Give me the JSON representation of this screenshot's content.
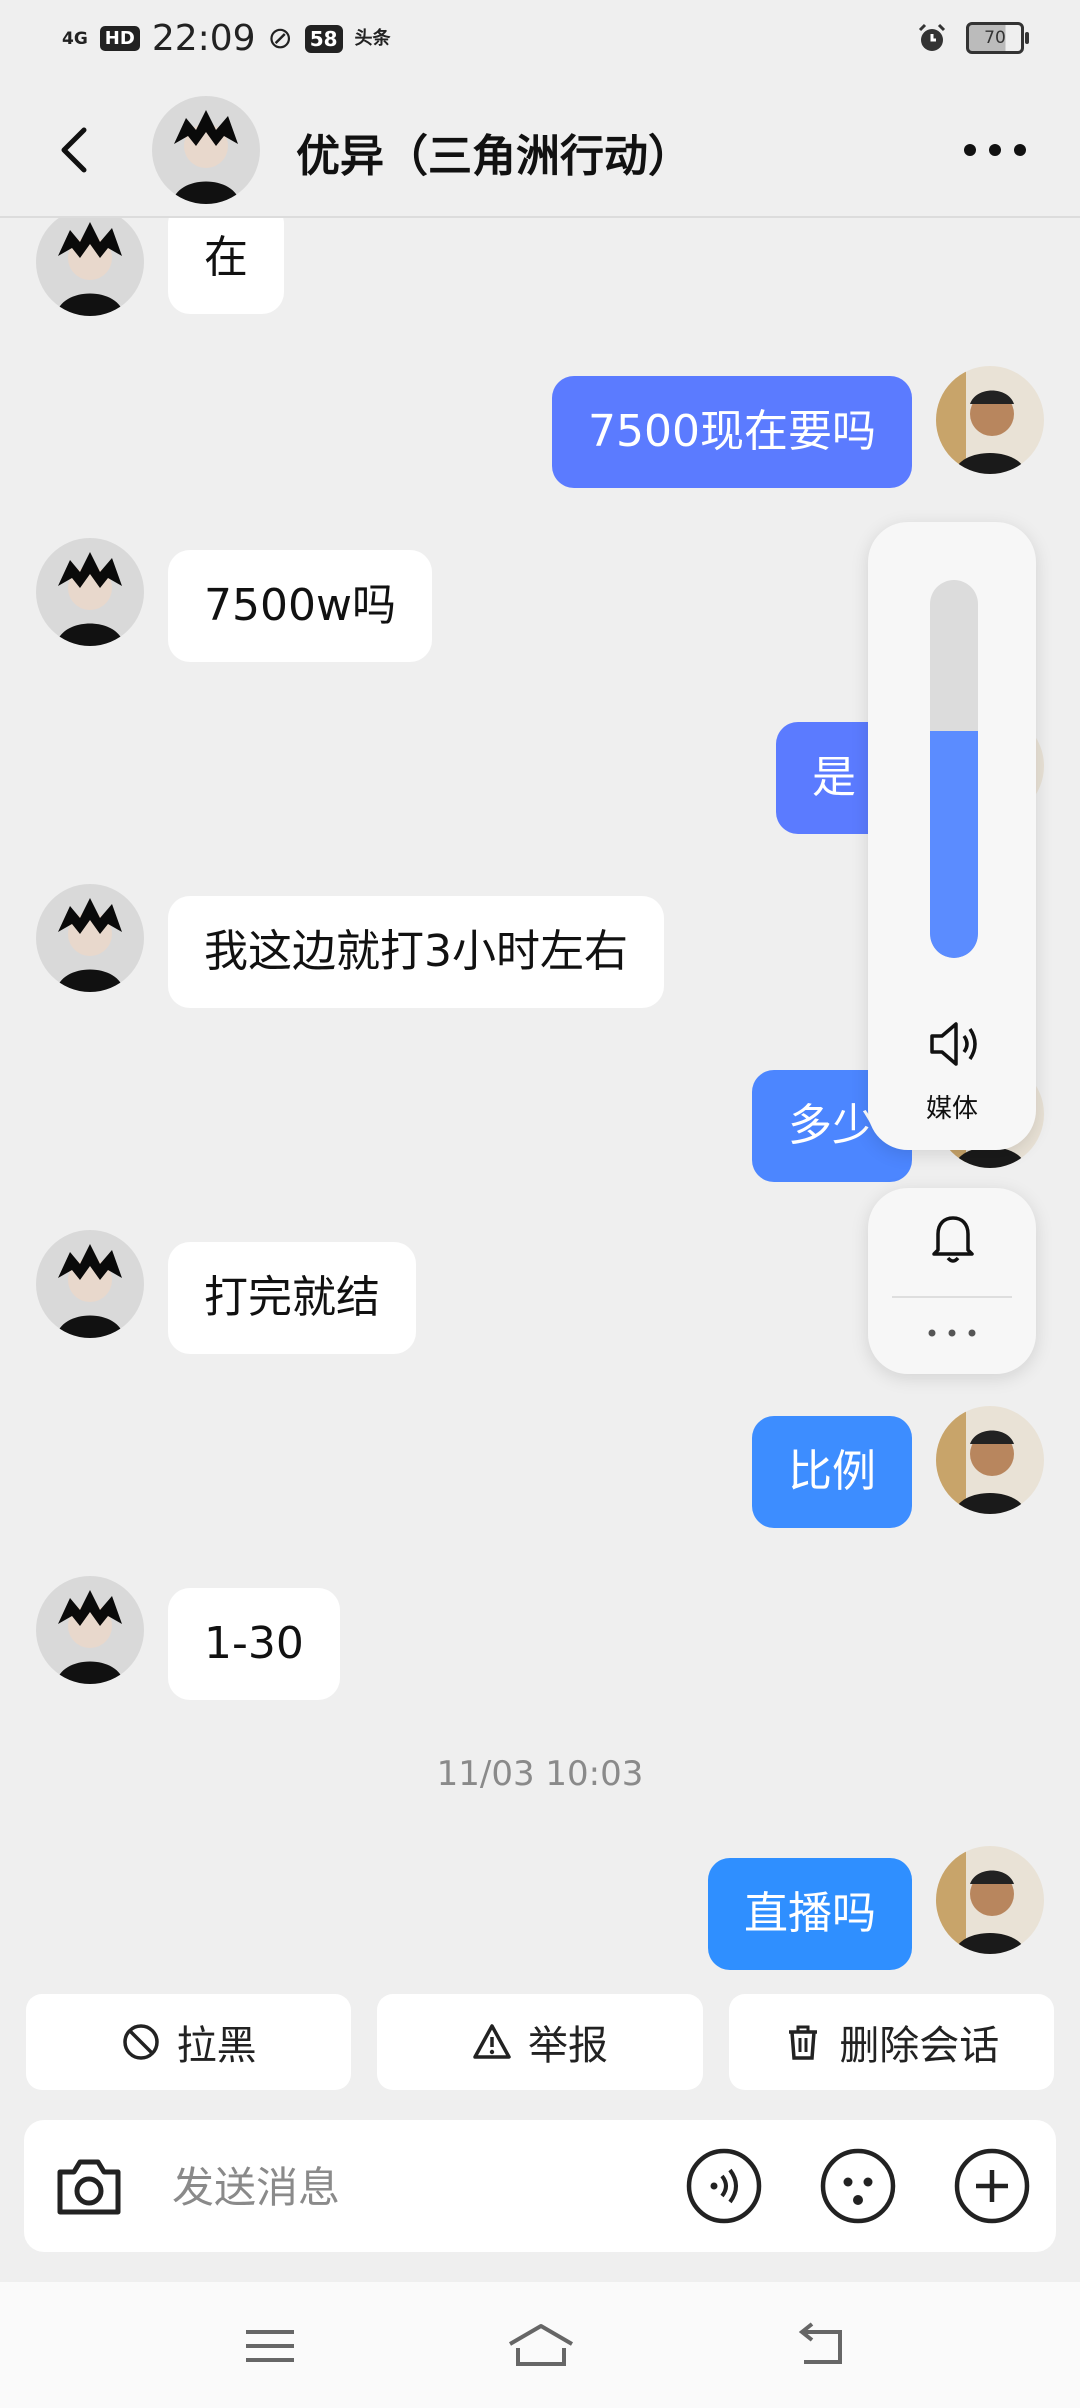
{
  "status_bar": {
    "network": "4G",
    "hd": "HD",
    "time": "22:09",
    "badge": "58",
    "app_tag": "头条",
    "battery": "70"
  },
  "header": {
    "title": "优异（三角洲行动）"
  },
  "messages": [
    {
      "side": "left",
      "text": "在"
    },
    {
      "side": "right",
      "text": "7500现在要吗",
      "color": "#5b7bff"
    },
    {
      "side": "left",
      "text": "7500w吗"
    },
    {
      "side": "right",
      "text": "是",
      "color": "#5b7bff"
    },
    {
      "side": "left",
      "text": "我这边就打3小时左右"
    },
    {
      "side": "right",
      "text": "多少",
      "color": "#4c86ff"
    },
    {
      "side": "left",
      "text": "打完就结"
    },
    {
      "side": "right",
      "text": "比例",
      "color": "#3d8dff"
    },
    {
      "side": "left",
      "text": "1-30"
    },
    {
      "side": "right",
      "text": "直播吗",
      "color": "#2f8fff"
    }
  ],
  "timestamp": "11/03 10:03",
  "actions": {
    "block": "拉黑",
    "report": "举报",
    "delete": "删除会话"
  },
  "input": {
    "placeholder": "发送消息"
  },
  "volume": {
    "level": 0.6,
    "label": "媒体"
  },
  "colors": {
    "background": "#efefef",
    "bubble_left": "#ffffff",
    "accent": "#5b8cff"
  }
}
